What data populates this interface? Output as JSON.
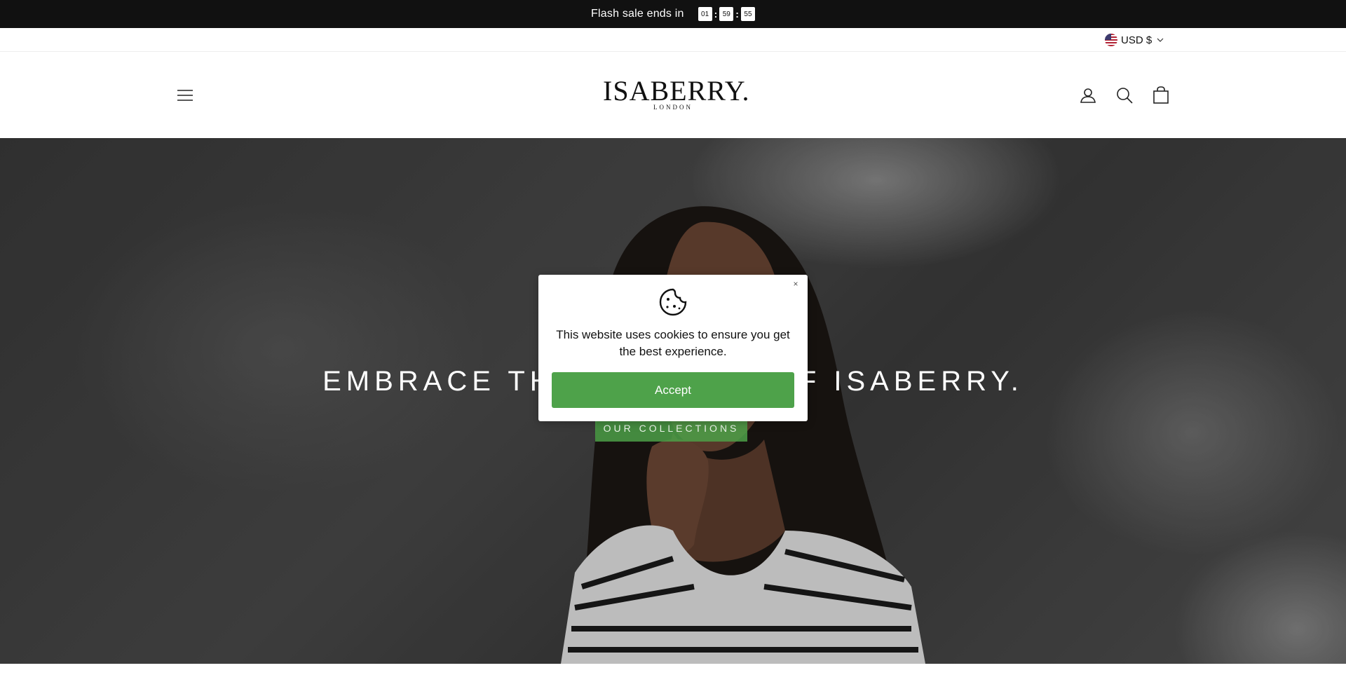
{
  "announcement": {
    "text": "Flash sale ends in",
    "timer": {
      "hours": "01",
      "minutes": "59",
      "seconds": "55"
    }
  },
  "utility": {
    "currency": "USD $"
  },
  "header": {
    "logo_main": "ISABERRY.",
    "logo_sub": "LONDON",
    "icons": [
      "hamburger-menu-icon",
      "user-icon",
      "search-icon",
      "bag-icon"
    ]
  },
  "hero": {
    "title": "EMBRACE THE ESSENCE OF ISABERRY.",
    "button": "OUR COLLECTIONS"
  },
  "cookie": {
    "message": "This website uses cookies to ensure you get the best experience.",
    "accept": "Accept",
    "close": "×"
  },
  "colors": {
    "accent_green": "#4ea24a",
    "announce_bg": "#111111"
  }
}
